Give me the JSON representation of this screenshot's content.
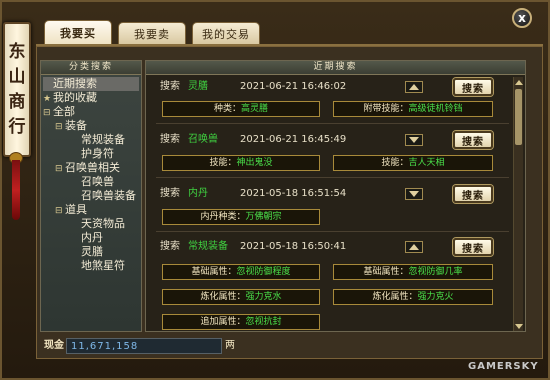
{
  "banner": {
    "chars": [
      "东",
      "山",
      "商",
      "行"
    ]
  },
  "close": "x",
  "tabs": [
    {
      "label": "我要买",
      "active": true
    },
    {
      "label": "我要卖",
      "active": false
    },
    {
      "label": "我的交易",
      "active": false
    }
  ],
  "left_panel": {
    "header": "分类搜索",
    "items": [
      {
        "icon": "",
        "label": "近期搜索",
        "selected": true
      },
      {
        "icon": "★",
        "label": "我的收藏"
      },
      {
        "icon": "⊟",
        "label": "全部"
      },
      {
        "icon": "⊟",
        "label": "装备"
      },
      {
        "icon": "",
        "label": "常规装备"
      },
      {
        "icon": "",
        "label": "护身符"
      },
      {
        "icon": "⊟",
        "label": "召唤兽相关"
      },
      {
        "icon": "",
        "label": "召唤兽"
      },
      {
        "icon": "",
        "label": "召唤兽装备"
      },
      {
        "icon": "⊟",
        "label": "道具"
      },
      {
        "icon": "",
        "label": "天资物品"
      },
      {
        "icon": "",
        "label": "内丹"
      },
      {
        "icon": "",
        "label": "灵膳"
      },
      {
        "icon": "",
        "label": "地煞星符"
      }
    ]
  },
  "right_panel": {
    "header": "近期搜索",
    "search_button_label": "搜索",
    "entries": [
      {
        "label": "搜索",
        "name": "灵膳",
        "time": "2021-06-21 16:46:02",
        "arrow": "up",
        "attrs": [
          {
            "key": "种类：",
            "value": "高灵膳"
          },
          {
            "key": "附带技能：",
            "value": "高级徒机铃铛"
          }
        ]
      },
      {
        "label": "搜索",
        "name": "召唤兽",
        "time": "2021-06-21 16:45:49",
        "arrow": "down",
        "attrs": [
          {
            "key": "技能：",
            "value": "神出鬼没"
          },
          {
            "key": "技能：",
            "value": "吉人天相"
          }
        ]
      },
      {
        "label": "搜索",
        "name": "内丹",
        "time": "2021-05-18 16:51:54",
        "arrow": "down",
        "attrs": [
          {
            "key": "内丹种类：",
            "value": "万佛朝宗"
          }
        ]
      },
      {
        "label": "搜索",
        "name": "常规装备",
        "time": "2021-05-18 16:50:41",
        "arrow": "up",
        "attrs": [
          {
            "key": "基础属性：",
            "value": "忽视防御程度"
          },
          {
            "key": "基础属性：",
            "value": "忽视防御几率"
          },
          {
            "key": "炼化属性：",
            "value": "强力克水"
          },
          {
            "key": "炼化属性：",
            "value": "强力克火"
          },
          {
            "key": "追加属性：",
            "value": "忽视抗封"
          }
        ]
      }
    ]
  },
  "money": {
    "label": "现金",
    "value": "11,671,158",
    "unit": "两"
  },
  "watermark": "GAMERSKY"
}
